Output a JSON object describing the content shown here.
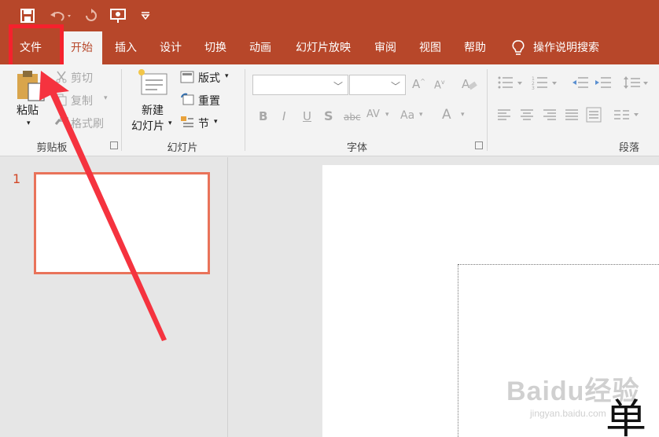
{
  "colors": {
    "accent": "#b7472a",
    "highlight": "#f5222d",
    "slide_number": "#d24726",
    "thumb_border": "#e9735a"
  },
  "quick_access": {
    "icons": [
      "save-icon",
      "undo-icon",
      "redo-icon",
      "present-from-start-icon",
      "customize-qat-icon"
    ]
  },
  "tabs": [
    {
      "label": "文件"
    },
    {
      "label": "开始"
    },
    {
      "label": "插入"
    },
    {
      "label": "设计"
    },
    {
      "label": "切换"
    },
    {
      "label": "动画"
    },
    {
      "label": "幻灯片放映"
    },
    {
      "label": "审阅"
    },
    {
      "label": "视图"
    },
    {
      "label": "帮助"
    }
  ],
  "search": {
    "label": "操作说明搜索"
  },
  "ribbon": {
    "clipboard": {
      "paste": "粘贴",
      "cut": "剪切",
      "copy": "复制",
      "format_painter": "格式刷",
      "group": "剪贴板"
    },
    "slides": {
      "new_slide_1": "新建",
      "new_slide_2": "幻灯片",
      "layout": "版式",
      "reset": "重置",
      "section": "节",
      "group": "幻灯片"
    },
    "font": {
      "group": "字体",
      "buttons": [
        "B",
        "I",
        "U",
        "S",
        "abc",
        "AV",
        "Aa",
        "A"
      ]
    },
    "paragraph": {
      "group": "段落"
    }
  },
  "thumbnails": {
    "slide_number": "1"
  },
  "watermark": {
    "line1": "Baidu经验",
    "line2": "jingyan.baidu.com"
  },
  "slide_text": "单"
}
